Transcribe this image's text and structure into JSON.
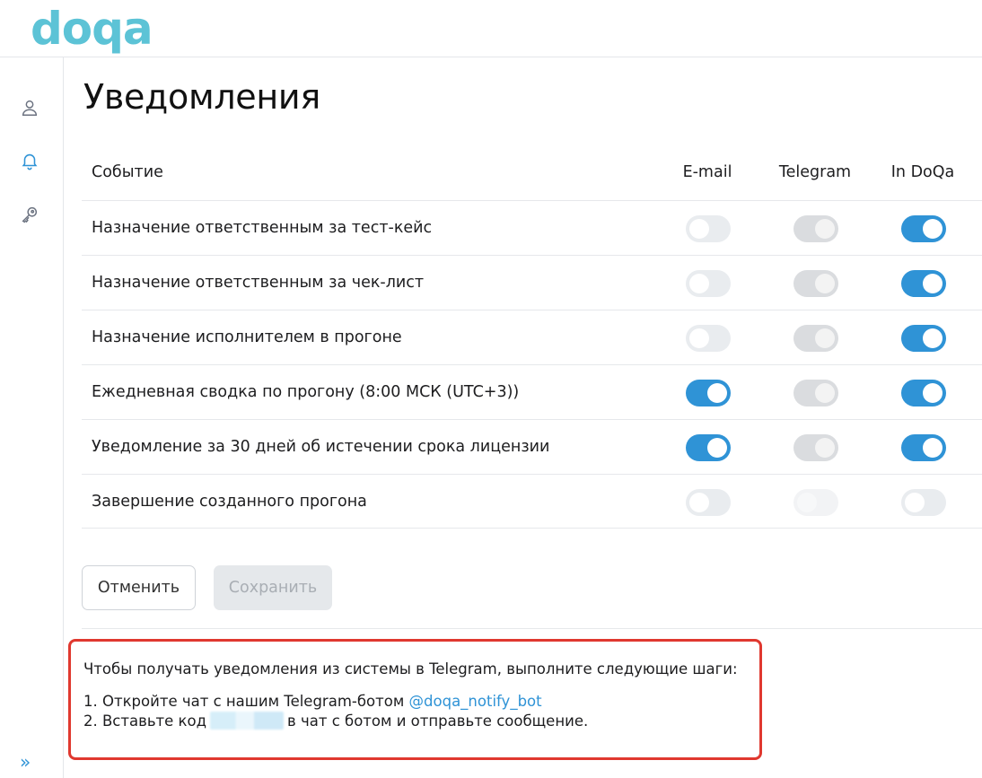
{
  "brand": {
    "logo": "doqa",
    "accent": "#2f93d6",
    "logo_color": "#5cc3d6"
  },
  "sidebar": {
    "items": [
      {
        "icon": "user-icon"
      },
      {
        "icon": "bell-icon",
        "active": true
      },
      {
        "icon": "key-icon"
      }
    ],
    "expand_label": "»"
  },
  "page": {
    "title": "Уведомления"
  },
  "table": {
    "headers": {
      "event": "Событие",
      "email": "E-mail",
      "telegram": "Telegram",
      "in_doqa": "In DoQa"
    },
    "rows": [
      {
        "label": "Назначение ответственным за тест-кейс",
        "email": false,
        "telegram": true,
        "in_doqa": true
      },
      {
        "label": "Назначение ответственным за чек-лист",
        "email": false,
        "telegram": true,
        "in_doqa": true
      },
      {
        "label": "Назначение исполнителем в прогоне",
        "email": false,
        "telegram": true,
        "in_doqa": true
      },
      {
        "label": "Ежедневная сводка по прогону (8:00 МСК (UTC+3))",
        "email": true,
        "telegram": true,
        "in_doqa": true
      },
      {
        "label": "Уведомление за 30 дней об истечении срока лицензии",
        "email": true,
        "telegram": true,
        "in_doqa": true
      },
      {
        "label": "Завершение созданного прогона",
        "email": false,
        "telegram": false,
        "in_doqa": false
      }
    ],
    "telegram_disabled": true
  },
  "actions": {
    "cancel_label": "Отменить",
    "save_label": "Сохранить"
  },
  "notice": {
    "intro": "Чтобы получать уведомления из системы в Telegram, выполните следующие шаги:",
    "step1_prefix": "1. Откройте чат с нашим Telegram-ботом ",
    "bot_link": "@doqa_notify_bot",
    "step2_prefix": "2. Вставьте код",
    "step2_suffix": "в чат с ботом и отправьте сообщение."
  }
}
